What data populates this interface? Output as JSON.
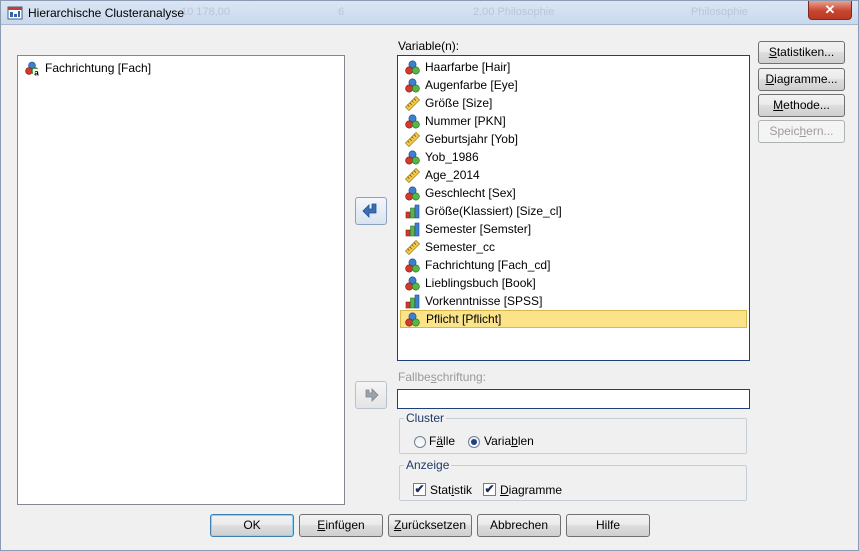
{
  "window": {
    "title": "Hierarchische Clusteranalyse",
    "ghost_text": [
      "10 178,00",
      "6",
      "2,00 Philosophie",
      "Philosophie"
    ]
  },
  "source_list": {
    "items": [
      {
        "label": "Fachrichtung [Fach]",
        "icon": "nominal-string-icon"
      }
    ]
  },
  "variables": {
    "label": "Variable(n):",
    "items": [
      {
        "label": "Haarfarbe [Hair]",
        "icon": "nominal-icon"
      },
      {
        "label": "Augenfarbe [Eye]",
        "icon": "nominal-icon"
      },
      {
        "label": "Größe [Size]",
        "icon": "scale-icon"
      },
      {
        "label": "Nummer [PKN]",
        "icon": "nominal-icon"
      },
      {
        "label": "Geburtsjahr [Yob]",
        "icon": "scale-icon"
      },
      {
        "label": "Yob_1986",
        "icon": "nominal-icon"
      },
      {
        "label": "Age_2014",
        "icon": "scale-icon"
      },
      {
        "label": "Geschlecht [Sex]",
        "icon": "nominal-icon"
      },
      {
        "label": "Größe(Klassiert) [Size_cl]",
        "icon": "ordinal-icon"
      },
      {
        "label": "Semester [Semster]",
        "icon": "ordinal-icon"
      },
      {
        "label": "Semester_cc",
        "icon": "scale-icon"
      },
      {
        "label": "Fachrichtung [Fach_cd]",
        "icon": "nominal-icon"
      },
      {
        "label": "Lieblingsbuch [Book]",
        "icon": "nominal-icon"
      },
      {
        "label": "Vorkenntnisse [SPSS]",
        "icon": "ordinal-icon"
      },
      {
        "label": "Pflicht [Pflicht]",
        "icon": "nominal-icon",
        "selected": true
      }
    ]
  },
  "fallbeschriftung": {
    "label_pre": "Fallbe",
    "label_u": "s",
    "label_post": "chriftung:",
    "value": ""
  },
  "cluster": {
    "title": "Cluster",
    "options": [
      {
        "pre": "F",
        "u": "ä",
        "post": "lle",
        "checked": false
      },
      {
        "pre": "Varia",
        "u": "b",
        "post": "len",
        "checked": true
      }
    ]
  },
  "anzeige": {
    "title": "Anzeige",
    "options": [
      {
        "pre": "Stat",
        "u": "i",
        "post": "stik",
        "checked": true
      },
      {
        "pre": "",
        "u": "D",
        "post": "iagramme",
        "checked": true
      }
    ]
  },
  "side_buttons": [
    {
      "pre": "",
      "u": "S",
      "post": "tatistiken...",
      "disabled": false
    },
    {
      "pre": "",
      "u": "D",
      "post": "iagramme...",
      "disabled": false
    },
    {
      "pre": "",
      "u": "M",
      "post": "ethode...",
      "disabled": false
    },
    {
      "pre": "Speic",
      "u": "h",
      "post": "ern...",
      "disabled": true
    }
  ],
  "bottom_buttons": [
    {
      "pre": "OK",
      "u": "",
      "post": "",
      "default": true
    },
    {
      "pre": "",
      "u": "E",
      "post": "infügen"
    },
    {
      "pre": "",
      "u": "Z",
      "post": "urücksetzen"
    },
    {
      "pre": "Abbrechen",
      "u": "",
      "post": ""
    },
    {
      "pre": "Hilfe",
      "u": "",
      "post": ""
    }
  ],
  "colors": {
    "selection": "#fbe38a",
    "title_gradient_top": "#dbe6f4",
    "close_red": "#c7452f",
    "group_title": "#1f3a6a"
  }
}
